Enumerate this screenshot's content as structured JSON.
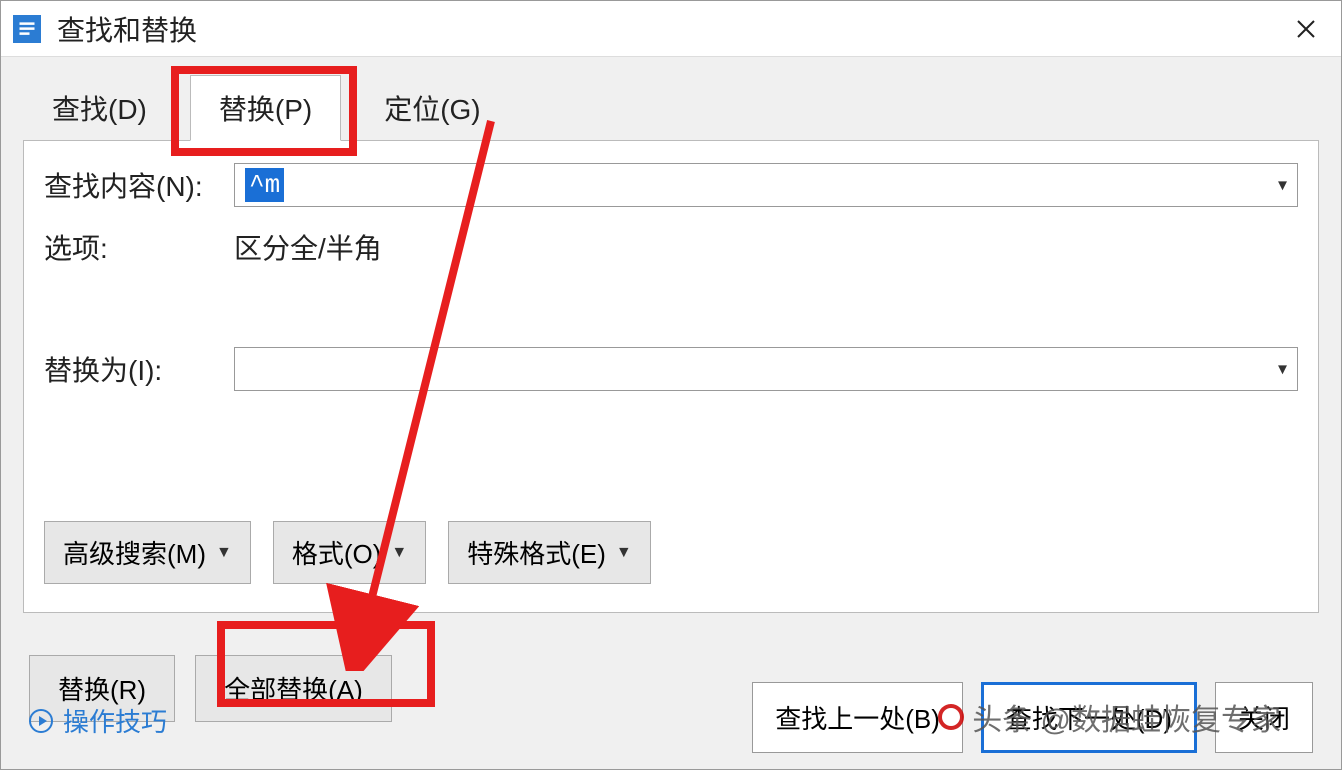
{
  "title": "查找和替换",
  "tabs": {
    "find": "查找(D)",
    "replace": "替换(P)",
    "goto": "定位(G)"
  },
  "labels": {
    "find_what": "查找内容(N):",
    "options": "选项:",
    "replace_with": "替换为(I):"
  },
  "values": {
    "find_what": "^m",
    "options": "区分全/半角",
    "replace_with": ""
  },
  "adv_buttons": {
    "advanced": "高级搜索(M)",
    "format": "格式(O)",
    "special": "特殊格式(E)"
  },
  "footer_buttons": {
    "replace": "替换(R)",
    "replace_all": "全部替换(A)"
  },
  "nav_buttons": {
    "prev": "查找上一处(B)",
    "next": "查找下一处(D)",
    "close": "关闭"
  },
  "tips": "操作技巧",
  "watermark": "头条 @数据蛙恢复专家"
}
